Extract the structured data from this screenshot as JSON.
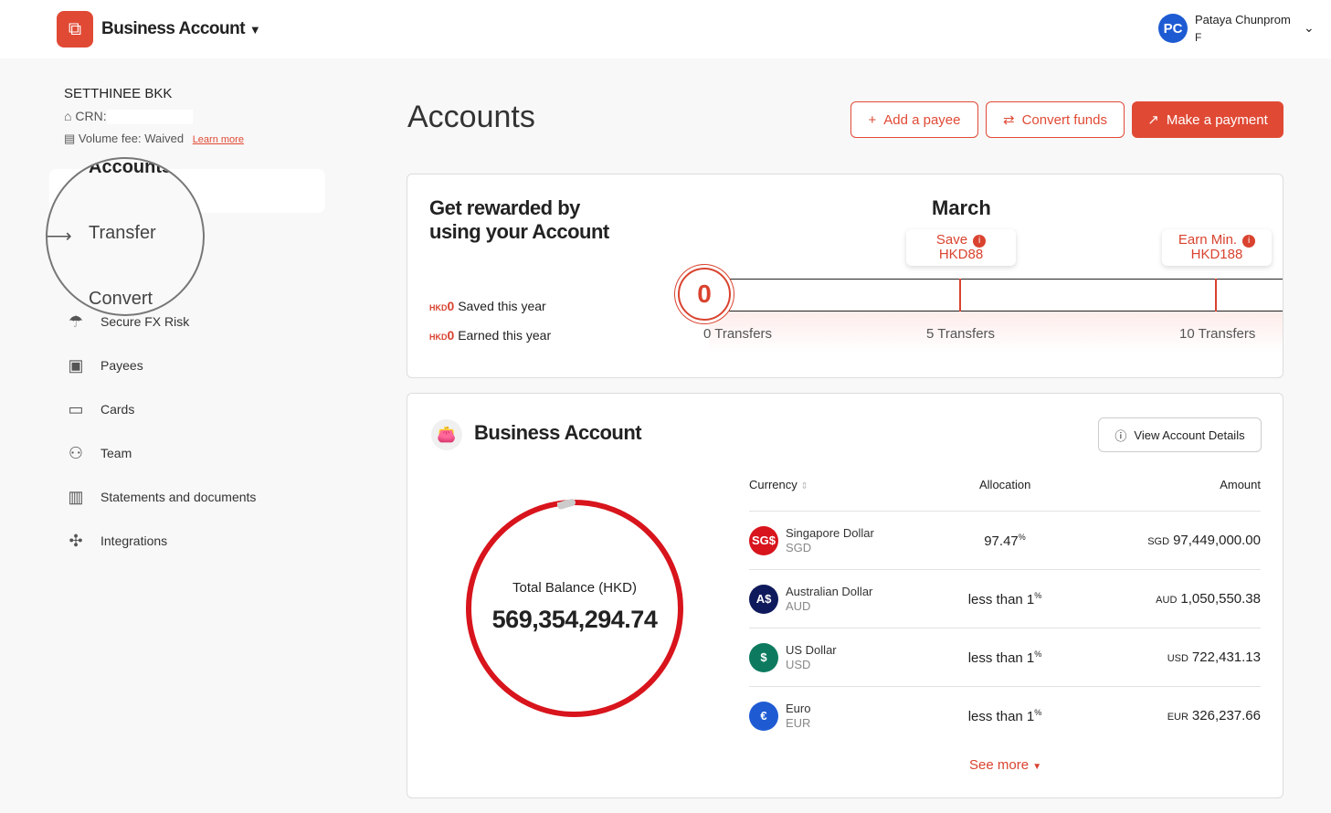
{
  "header": {
    "brand": "Business Account",
    "user_name": "Pataya Chunprom",
    "user_initials": "PC",
    "user_sub": "F"
  },
  "sidebar": {
    "company": "SETTHINEE BKK",
    "crn_label": "CRN:",
    "volume_fee": "Volume fee: Waived",
    "learn_more": "Learn more",
    "magnifier": {
      "accounts": "Accounts",
      "transfer": "Transfer",
      "convert": "Convert"
    },
    "items": [
      {
        "label": "Secure FX Risk",
        "icon": "umbrella-icon"
      },
      {
        "label": "Payees",
        "icon": "contact-book-icon"
      },
      {
        "label": "Cards",
        "icon": "card-icon"
      },
      {
        "label": "Team",
        "icon": "team-icon"
      },
      {
        "label": "Statements and documents",
        "icon": "book-icon"
      },
      {
        "label": "Integrations",
        "icon": "puzzle-icon"
      }
    ]
  },
  "page": {
    "title": "Accounts",
    "add_payee": "Add a payee",
    "convert_funds": "Convert funds",
    "make_payment": "Make a payment"
  },
  "rewards": {
    "title_line1": "Get rewarded by",
    "title_line2": "using your Account",
    "month": "March",
    "currency_tag": "HKD",
    "saved_value": "0",
    "saved_label": "Saved this year",
    "earned_value": "0",
    "earned_label": "Earned this year",
    "current_transfers": "0",
    "tip1_line1": "Save",
    "tip1_line2": "HKD88",
    "tip2_line1": "Earn Min.",
    "tip2_line2": "HKD188",
    "ticks": [
      "0 Transfers",
      "5 Transfers",
      "10 Transfers"
    ]
  },
  "account": {
    "title": "Business Account",
    "view_details": "View Account Details",
    "balance_label": "Total Balance (HKD)",
    "balance": "569,354,294.74",
    "columns": {
      "currency": "Currency",
      "allocation": "Allocation",
      "amount": "Amount"
    },
    "rows": [
      {
        "symbol": "SG$",
        "name": "Singapore Dollar",
        "code": "SGD",
        "allocation": "97.47",
        "unit": "%",
        "amount": "97,449,000.00",
        "color": "#d8141c"
      },
      {
        "symbol": "A$",
        "name": "Australian Dollar",
        "code": "AUD",
        "allocation": "less than 1",
        "unit": "%",
        "amount": "1,050,550.38",
        "color": "#0f1a5c"
      },
      {
        "symbol": "$",
        "name": "US Dollar",
        "code": "USD",
        "allocation": "less than 1",
        "unit": "%",
        "amount": "722,431.13",
        "color": "#0d7a5f"
      },
      {
        "symbol": "€",
        "name": "Euro",
        "code": "EUR",
        "allocation": "less than 1",
        "unit": "%",
        "amount": "326,237.66",
        "color": "#1e5bd3"
      }
    ],
    "see_more": "See more"
  },
  "colors": {
    "accent": "#e04a35"
  }
}
